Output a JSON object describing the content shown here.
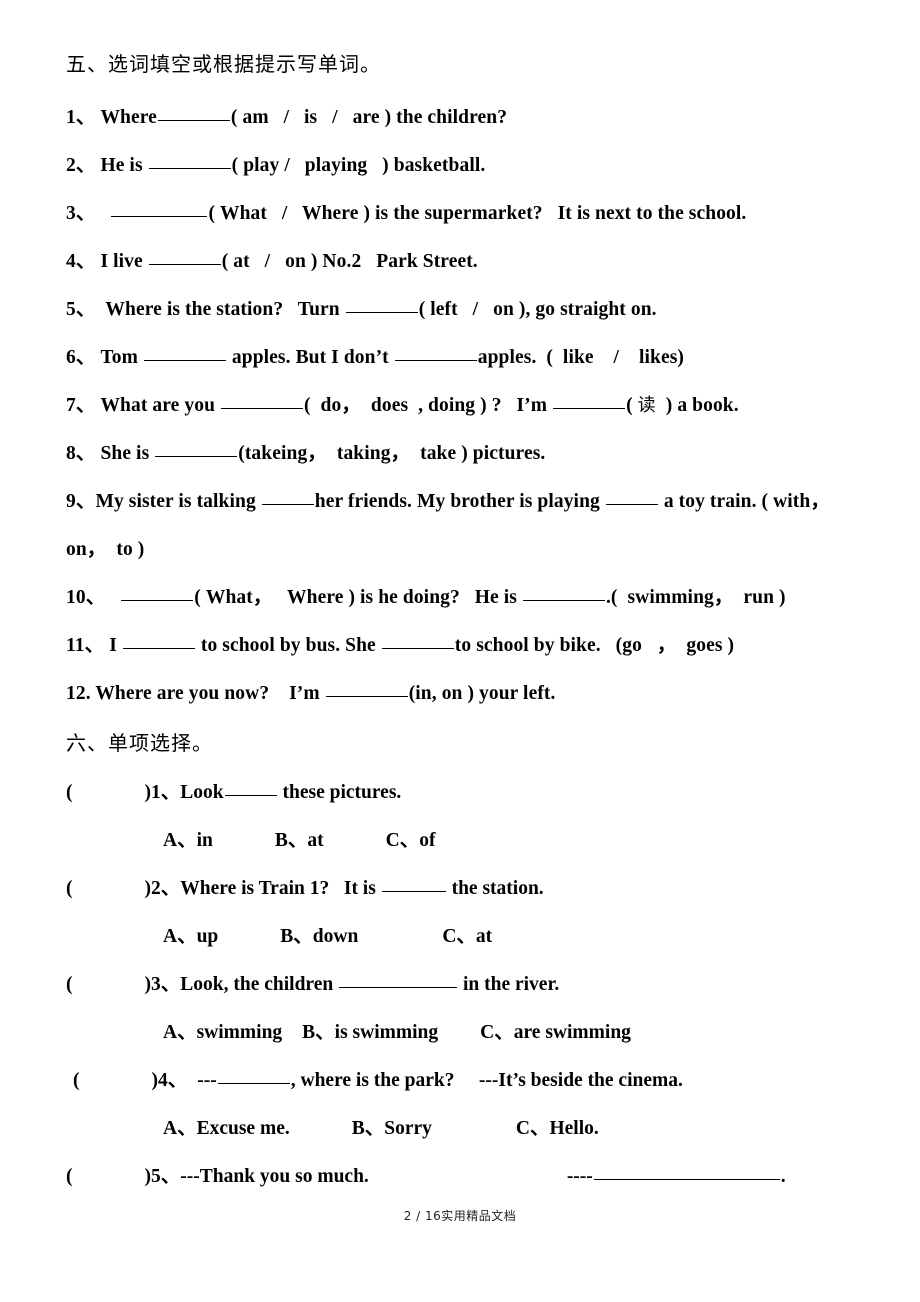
{
  "document": {
    "footer": "2 / 16实用精品文档",
    "page_number": "2",
    "total_pages": "16",
    "footer_label": "实用精品文档"
  },
  "section_five": {
    "heading": "五、选词填空或根据提示写单词。",
    "items": [
      {
        "number": "1、",
        "before": "Where",
        "after": "( am   /   is   /   are ) the children?"
      },
      {
        "number": "2、",
        "before": "He is ",
        "after": "( play /   playing   ) basketball."
      },
      {
        "number": "3、",
        "before": "",
        "after": "( What   /   Where ) is the supermarket?   It is next to the school."
      },
      {
        "number": "4、",
        "before": "I live ",
        "after": "( at   /   on ) No.2   Park Street."
      },
      {
        "number": "5、",
        "before": " Where is the station?   Turn ",
        "after": "( left   /   on ), go straight on."
      },
      {
        "number": "6、",
        "before": "Tom ",
        "middle": " apples. But I don’t ",
        "after": "apples.  (  like    /    likes)"
      },
      {
        "number": "7、",
        "before": "What are you ",
        "middle": "(  do，  does  , doing ) ?   I’m ",
        "cn": "读",
        "after": ") a book.",
        "paren_open": "( "
      },
      {
        "number": "8、",
        "before": "She is ",
        "after": "(takeing，  taking，  take ) pictures."
      },
      {
        "number": "9、",
        "before": "My sister is talking ",
        "middle": "her friends. My brother is playing ",
        "after": " a toy train. ( with，",
        "wrap": "on，  to )"
      },
      {
        "number": "10、",
        "before": "",
        "middle": "( What，   Where ) is he doing?   He is ",
        "after": ".(  swimming，  run )"
      },
      {
        "number": "11、",
        "before": "I ",
        "middle": " to school by bus. She ",
        "after": "to school by bike.   (go   ，  goes )"
      },
      {
        "number": "12.",
        "before": "Where are you now?    I’m ",
        "after": "(in, on ) your left."
      }
    ]
  },
  "section_six": {
    "heading": "六、单项选择。",
    "questions": [
      {
        "bracket_open": "(",
        "bracket_close": ")",
        "number": "1、",
        "stem_before": "Look",
        "stem_after": " these pictures.",
        "options": [
          "A、in",
          "B、at",
          "C、of"
        ]
      },
      {
        "bracket_open": "(",
        "bracket_close": ")",
        "number": "2、",
        "stem_before": "Where is Train 1?   It is ",
        "stem_after": " the station.",
        "options": [
          "A、up",
          "B、down",
          "C、at"
        ]
      },
      {
        "bracket_open": "(",
        "bracket_close": ")",
        "number": "3、",
        "stem_before": "Look, the children ",
        "stem_after": " in the river.",
        "options": [
          "A、swimming",
          "B、is swimming",
          "C、are swimming"
        ]
      },
      {
        "bracket_open": "(",
        "bracket_close": ")",
        "number": "4、",
        "stem_before": "---",
        "stem_after": ", where is the park?     ---It’s beside the cinema.",
        "options": [
          "A、Excuse me.",
          "B、Sorry",
          "C、Hello."
        ]
      },
      {
        "bracket_open": "(",
        "bracket_close": ")",
        "number": "5、",
        "stem_before": "---Thank you so much.",
        "stem_dash": "----",
        "stem_after": ".",
        "options": []
      }
    ]
  }
}
